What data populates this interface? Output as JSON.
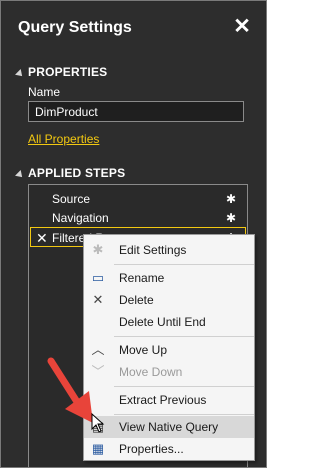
{
  "panel": {
    "title": "Query Settings",
    "close_icon": "close-icon"
  },
  "properties": {
    "header": "PROPERTIES",
    "name_label": "Name",
    "name_value": "DimProduct",
    "all_properties_link": "All Properties"
  },
  "applied_steps": {
    "header": "APPLIED STEPS",
    "steps": [
      {
        "label": "Source"
      },
      {
        "label": "Navigation"
      },
      {
        "label": "Filtered Rows"
      }
    ]
  },
  "context_menu": {
    "items": [
      {
        "label": "Edit Settings",
        "icon": "gear-icon",
        "disabled": false
      },
      {
        "label": "Rename",
        "icon": "rename-icon",
        "disabled": false
      },
      {
        "label": "Delete",
        "icon": "close-icon",
        "disabled": false
      },
      {
        "label": "Delete Until End",
        "icon": "",
        "disabled": false
      },
      {
        "label": "Move Up",
        "icon": "chevron-up-icon",
        "disabled": false
      },
      {
        "label": "Move Down",
        "icon": "chevron-down-icon",
        "disabled": true
      },
      {
        "label": "Extract Previous",
        "icon": "",
        "disabled": false
      },
      {
        "label": "View Native Query",
        "icon": "native-query-icon",
        "disabled": false,
        "highlighted": true
      },
      {
        "label": "Properties...",
        "icon": "properties-icon",
        "disabled": false
      }
    ]
  },
  "colors": {
    "accent": "#f2c811",
    "pane_bg": "#2d2d2d",
    "annotation_arrow": "#e8443a"
  }
}
